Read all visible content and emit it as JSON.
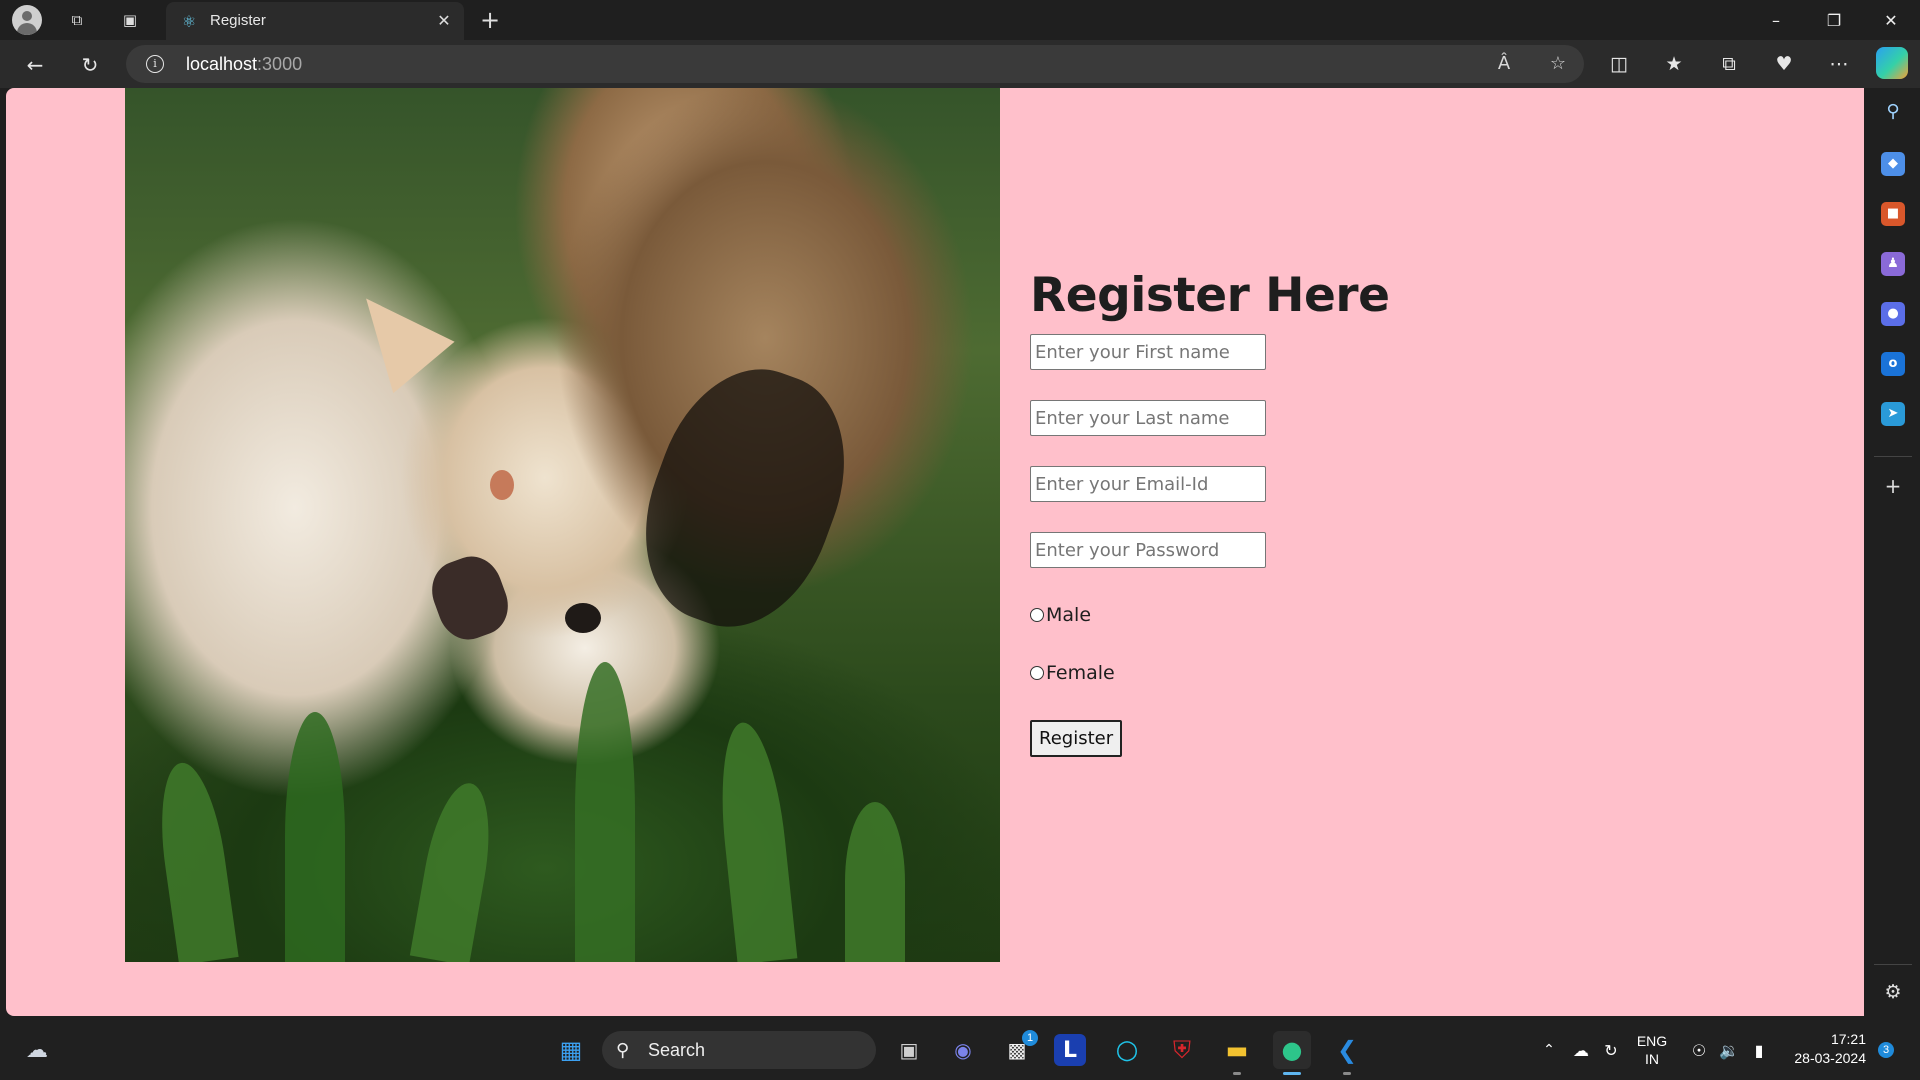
{
  "browser": {
    "tab_title": "Register",
    "tab_favicon": "react-icon",
    "new_tab_label": "+",
    "url_host": "localhost",
    "url_port": ":3000"
  },
  "page": {
    "heading": "Register Here",
    "image_alt": "cat-and-dog-photo",
    "fields": {
      "first_name_placeholder": "Enter your First name",
      "last_name_placeholder": "Enter your Last name",
      "email_placeholder": "Enter your Email-Id",
      "password_placeholder": "Enter your Password"
    },
    "gender": {
      "male": "Male",
      "female": "Female"
    },
    "register_button": "Register",
    "background_color": "#ffc0cb"
  },
  "taskbar": {
    "search_label": "Search",
    "store_badge": "1",
    "lang_top": "ENG",
    "lang_bottom": "IN",
    "time": "17:21",
    "date": "28-03-2024",
    "notification_count": "3"
  }
}
